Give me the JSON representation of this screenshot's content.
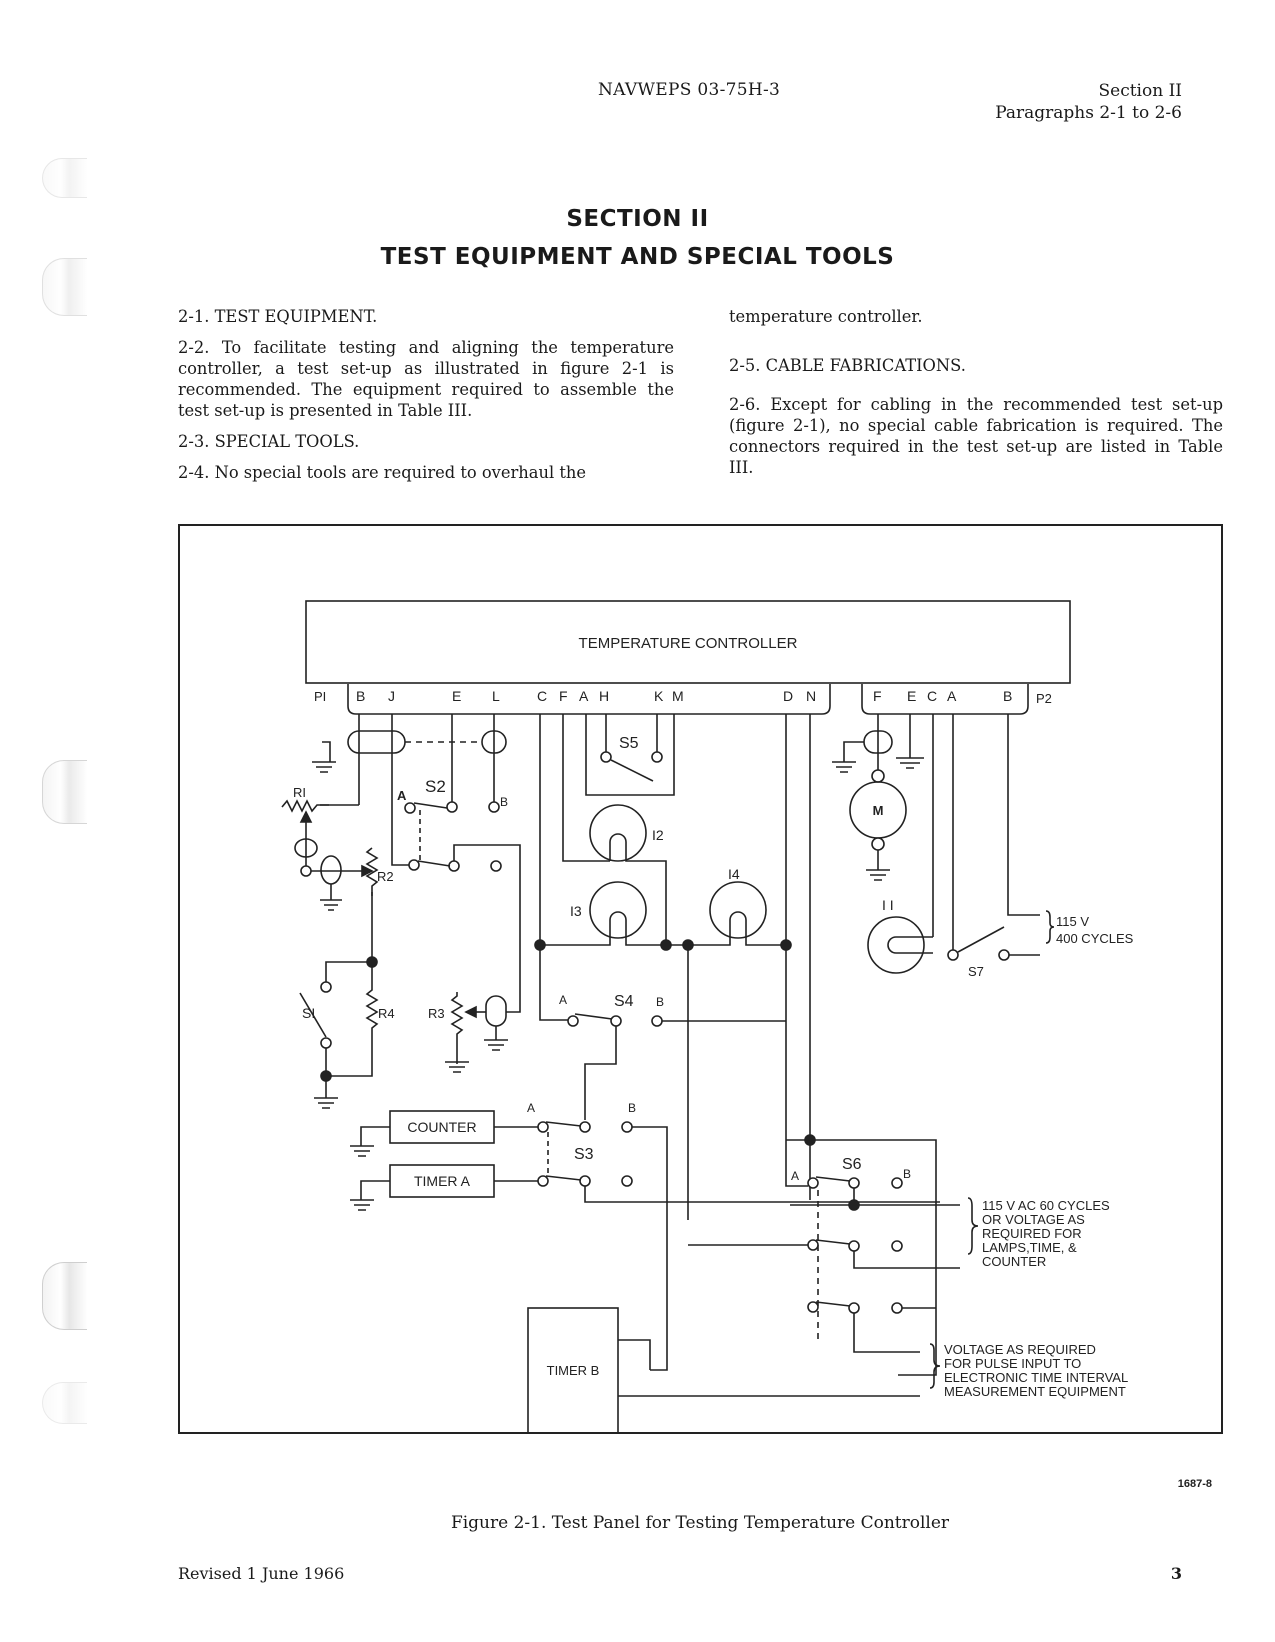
{
  "header": {
    "doc_number": "NAVWEPS 03-75H-3",
    "section": "Section II",
    "paragraphs": "Paragraphs 2-1 to 2-6"
  },
  "title": {
    "section": "SECTION II",
    "heading": "TEST EQUIPMENT AND SPECIAL TOOLS"
  },
  "body": {
    "p2_1": "2-1. TEST EQUIPMENT.",
    "p2_2": "2-2. To facilitate testing and aligning the temperature controller, a test set-up as illustrated in figure 2-1 is recommended. The equipment required to assemble the test set-up is presented in Table III.",
    "p2_3": "2-3. SPECIAL TOOLS.",
    "p2_4": "2-4. No special tools are required to overhaul the temperature controller.",
    "p2_5": "2-5. CABLE FABRICATIONS.",
    "p2_6": "2-6. Except for cabling in the recommended test set-up (figure 2-1), no special cable fabrication is required. The connectors required in the test set-up are listed in Table III."
  },
  "figure": {
    "controller_label": "TEMPERATURE CONTROLLER",
    "p1_label": "PI",
    "p2_label": "P2",
    "p1_pins": [
      "B",
      "J",
      "E",
      "L",
      "C",
      "F",
      "A",
      "H",
      "K",
      "M",
      "D",
      "N"
    ],
    "p2_pins": [
      "F",
      "E",
      "C",
      "A",
      "B"
    ],
    "components": {
      "r1": "RI",
      "r2": "R2",
      "r3": "R3",
      "r4": "R4",
      "s1": "SI",
      "s2": "S2",
      "s3": "S3",
      "s4": "S4",
      "s5": "S5",
      "s6": "S6",
      "s7": "S7",
      "i1": "I I",
      "i2": "I2",
      "i3": "I3",
      "i4": "I4",
      "motor": "M",
      "counter": "COUNTER",
      "timer_a": "TIMER A",
      "timer_b": "TIMER B",
      "pos_a": "A",
      "pos_b": "B"
    },
    "notes": {
      "supply_400": [
        "115 V",
        "400 CYCLES"
      ],
      "supply_60": [
        "115 V AC 60 CYCLES",
        "OR VOLTAGE AS",
        "REQUIRED FOR",
        "LAMPS,TIME, &",
        "COUNTER"
      ],
      "pulse": [
        "VOLTAGE AS REQUIRED",
        "FOR PULSE INPUT TO",
        "ELECTRONIC TIME INTERVAL",
        "MEASUREMENT EQUIPMENT"
      ]
    },
    "drawing_number": "1687-8",
    "caption": "Figure 2-1. Test Panel for Testing Temperature Controller"
  },
  "footer": {
    "revised": "Revised 1 June 1966",
    "page_number": "3"
  }
}
